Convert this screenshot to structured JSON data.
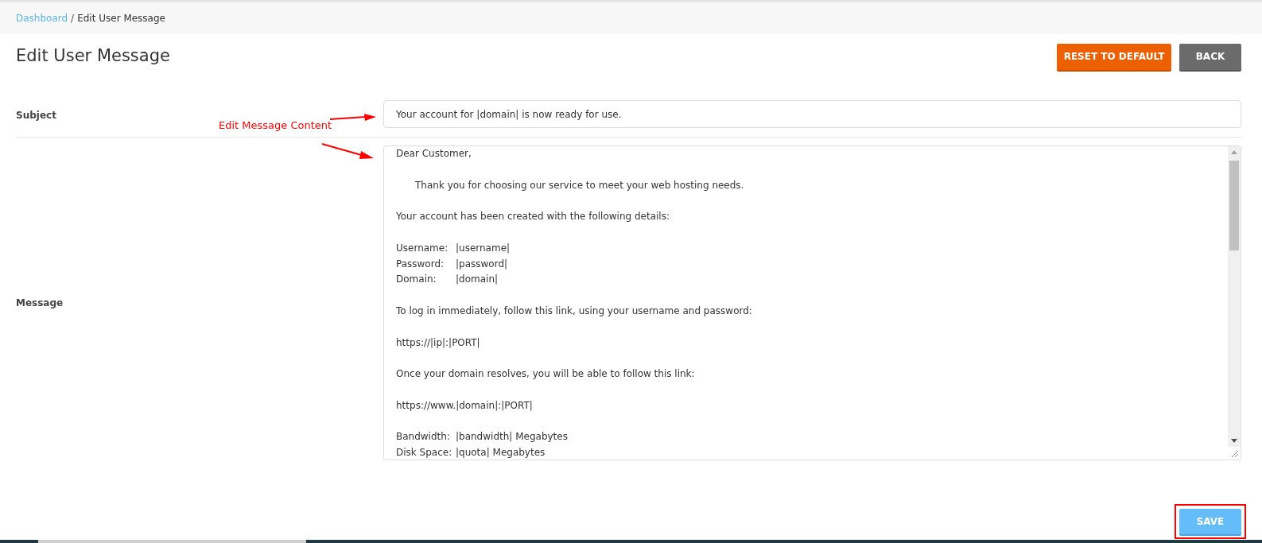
{
  "breadcrumb": {
    "link": "Dashboard",
    "separator": "/",
    "current": "Edit User Message"
  },
  "title": "Edit User Message",
  "header_buttons": [
    {
      "kind": "reset",
      "label": "RESET TO DEFAULT"
    },
    {
      "kind": "back",
      "label": "BACK"
    }
  ],
  "subject": {
    "label": "Subject",
    "value": "Your account for |domain| is now ready for use."
  },
  "annotation": "Edit Message Content",
  "message": {
    "label": "Message",
    "lines": [
      {
        "kind": "text",
        "text": "Dear Customer,"
      },
      {
        "kind": "blank"
      },
      {
        "kind": "indented",
        "text": "Thank you for choosing our service to meet your web hosting needs."
      },
      {
        "kind": "blank"
      },
      {
        "kind": "text",
        "text": "Your account has been created with the following details:"
      },
      {
        "kind": "blank"
      },
      {
        "kind": "field",
        "label": "Username:",
        "value": "|username|"
      },
      {
        "kind": "field",
        "label": "Password:",
        "value": "|password|"
      },
      {
        "kind": "field",
        "label": "Domain:",
        "value": "|domain|"
      },
      {
        "kind": "blank"
      },
      {
        "kind": "text",
        "text": "To log in immediately, follow this link, using your username and password:"
      },
      {
        "kind": "blank"
      },
      {
        "kind": "text",
        "text": "https://|ip|:|PORT|"
      },
      {
        "kind": "blank"
      },
      {
        "kind": "text",
        "text": "Once your domain resolves, you will be able to follow this link:"
      },
      {
        "kind": "blank"
      },
      {
        "kind": "text",
        "text": "https://www.|domain|:|PORT|"
      },
      {
        "kind": "blank"
      },
      {
        "kind": "field",
        "label": "Bandwidth:",
        "value": "|bandwidth| Megabytes"
      },
      {
        "kind": "field",
        "label": "Disk Space:",
        "value": "|quota| Megabytes"
      }
    ]
  },
  "save_button": "SAVE"
}
